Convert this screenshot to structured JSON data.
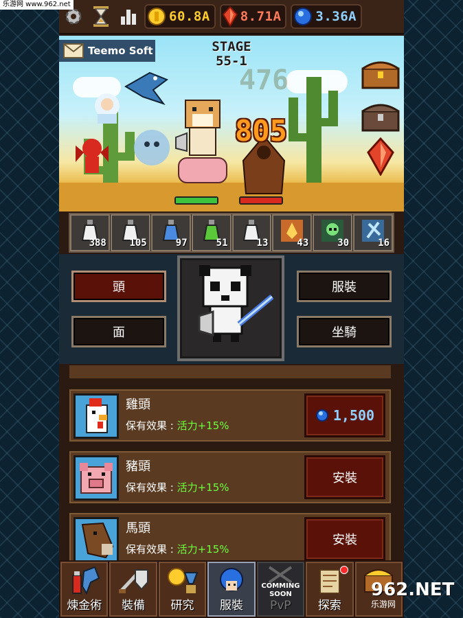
{
  "watermark_top": "乐游网 www.962.net",
  "watermark_bottom": {
    "big": "962.NET",
    "small": "乐游网"
  },
  "topbar": {
    "icons": [
      "gear-icon",
      "hourglass-icon",
      "stats-icon"
    ],
    "gold": "60.8A",
    "ruby": "8.71A",
    "sapphire": "3.36A"
  },
  "scene": {
    "mail_sender": "Teemo Soft",
    "stage_label": "STAGE",
    "stage_number": "55-1",
    "damage_ghost": "476",
    "damage_main": "805",
    "player_hp_color": "#3ec33e",
    "enemy_hp_color": "#d82a1e"
  },
  "items": [
    {
      "icon": "white-potion-icon",
      "count": "388"
    },
    {
      "icon": "white-potion-icon",
      "count": "105"
    },
    {
      "icon": "blue-potion-icon",
      "count": "97"
    },
    {
      "icon": "green-potion-icon",
      "count": "51"
    },
    {
      "icon": "white-potion-icon",
      "count": "13"
    },
    {
      "icon": "fire-scroll-icon",
      "count": "43"
    },
    {
      "icon": "poison-skull-icon",
      "count": "30"
    },
    {
      "icon": "ice-scroll-icon",
      "count": "16"
    }
  ],
  "equipment": {
    "head": "頭",
    "face": "面",
    "costume": "服裝",
    "mount": "坐騎"
  },
  "list": [
    {
      "name": "雞頭",
      "effect_label": "保有效果 :",
      "effect_value": "活力+15%",
      "action_type": "price",
      "price": "1,500"
    },
    {
      "name": "豬頭",
      "effect_label": "保有效果 :",
      "effect_value": "活力+15%",
      "action_type": "install",
      "action": "安裝"
    },
    {
      "name": "馬頭",
      "effect_label": "保有效果 :",
      "effect_value": "活力+15%",
      "action_type": "install",
      "action": "安裝"
    }
  ],
  "nav": [
    {
      "label": "煉金術",
      "icon": "alchemy-icon"
    },
    {
      "label": "裝備",
      "icon": "sword-shield-icon"
    },
    {
      "label": "研究",
      "icon": "research-icon"
    },
    {
      "label": "服裝",
      "icon": "costume-icon",
      "active": true
    },
    {
      "label": "PvP",
      "icon": "pvp-icon",
      "coming": "COMMING SOON"
    },
    {
      "label": "探索",
      "icon": "scroll-map-icon"
    },
    {
      "label": "",
      "icon": "treasure-icon"
    }
  ]
}
